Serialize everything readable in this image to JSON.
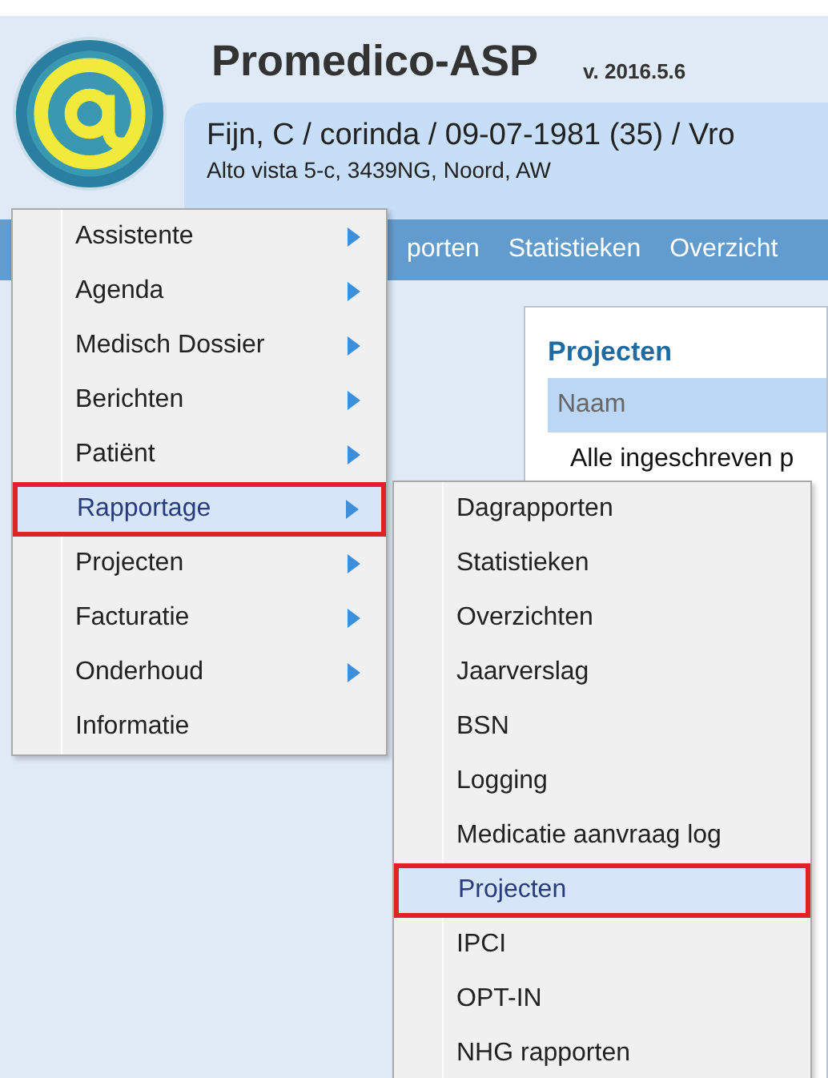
{
  "app": {
    "title": "Promedico-ASP",
    "version": "v. 2016.5.6"
  },
  "patient": {
    "line": "Fijn, C / corinda / 09-07-1981 (35) / Vro",
    "address": "Alto vista 5-c, 3439NG, Noord, AW"
  },
  "nav_bar": {
    "items": [
      "porten",
      "Statistieken",
      "Overzicht"
    ]
  },
  "panel": {
    "title": "Projecten",
    "columns": [
      "Naam"
    ],
    "rows": [
      [
        "Alle ingeschreven p"
      ]
    ]
  },
  "menu": {
    "items": [
      {
        "label": "Assistente",
        "has_submenu": true,
        "selected": false,
        "annotated": false
      },
      {
        "label": "Agenda",
        "has_submenu": true,
        "selected": false,
        "annotated": false
      },
      {
        "label": "Medisch Dossier",
        "has_submenu": true,
        "selected": false,
        "annotated": false
      },
      {
        "label": "Berichten",
        "has_submenu": true,
        "selected": false,
        "annotated": false
      },
      {
        "label": "Patiënt",
        "has_submenu": true,
        "selected": false,
        "annotated": false
      },
      {
        "label": "Rapportage",
        "has_submenu": true,
        "selected": true,
        "annotated": true
      },
      {
        "label": "Projecten",
        "has_submenu": true,
        "selected": false,
        "annotated": false
      },
      {
        "label": "Facturatie",
        "has_submenu": true,
        "selected": false,
        "annotated": false
      },
      {
        "label": "Onderhoud",
        "has_submenu": true,
        "selected": false,
        "annotated": false
      },
      {
        "label": "Informatie",
        "has_submenu": false,
        "selected": false,
        "annotated": false
      }
    ]
  },
  "submenu": {
    "items": [
      {
        "label": "Dagrapporten",
        "selected": false,
        "annotated": false
      },
      {
        "label": "Statistieken",
        "selected": false,
        "annotated": false
      },
      {
        "label": "Overzichten",
        "selected": false,
        "annotated": false
      },
      {
        "label": "Jaarverslag",
        "selected": false,
        "annotated": false
      },
      {
        "label": "BSN",
        "selected": false,
        "annotated": false
      },
      {
        "label": "Logging",
        "selected": false,
        "annotated": false
      },
      {
        "label": "Medicatie aanvraag log",
        "selected": false,
        "annotated": false
      },
      {
        "label": "Projecten",
        "selected": true,
        "annotated": true
      },
      {
        "label": "IPCI",
        "selected": false,
        "annotated": false
      },
      {
        "label": "OPT-IN",
        "selected": false,
        "annotated": false
      },
      {
        "label": "NHG rapporten",
        "selected": false,
        "annotated": false
      }
    ]
  }
}
